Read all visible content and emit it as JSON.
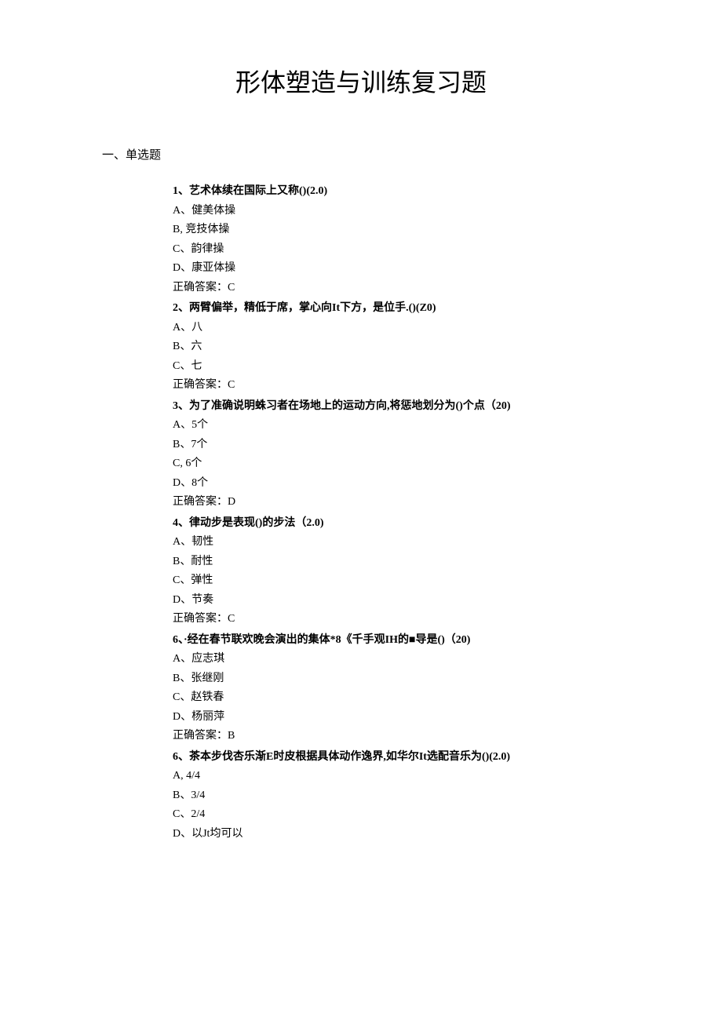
{
  "title": "形体塑造与训练复习题",
  "sectionHeader": "一、单选题",
  "questions": [
    {
      "num": "1",
      "text": "、艺术体续在国际上又称()(2.0)",
      "options": [
        "A、健美体操",
        "B, 竞技体操",
        "C、韵律操",
        "D、康亚体操"
      ],
      "answer": "正确答案：C"
    },
    {
      "num": "2",
      "text": "、两臂偏举，精低于席，掌心向It下方，是位手.()(Z0)",
      "options": [
        "A、八",
        "B、六",
        "C、七"
      ],
      "answer": "正确答案：C"
    },
    {
      "num": "3",
      "text": "、为了准确说明蛛习者在场地上的运动方向,将惩地划分为()个点（20)",
      "options": [
        "A、5个",
        "B、7个",
        "C, 6个",
        "D、8个"
      ],
      "answer": "正确答案：D"
    },
    {
      "num": "4",
      "text": "、律动步是表现()的步法（2.0)",
      "options": [
        "A、韧性",
        "B、耐性",
        "C、弹性",
        "D、节奏"
      ],
      "answer": "正确答案：C"
    },
    {
      "num": "6",
      "text": "、·经在春节联欢晚会演出的集体*8《千手观IH的■导是()（20)",
      "options": [
        "A、应志琪",
        "B、张继刚",
        "C、赵铁春",
        "D、杨丽萍"
      ],
      "answer": "正确答案：B"
    },
    {
      "num": "6",
      "text": "、茶本步伐杏乐渐E时皮根据具体动作逸界,如华尔It选配音乐为()(2.0)",
      "options": [
        "A, 4/4",
        "B、3/4",
        "C、2/4",
        "D、以Jt均可以"
      ],
      "answer": ""
    }
  ]
}
